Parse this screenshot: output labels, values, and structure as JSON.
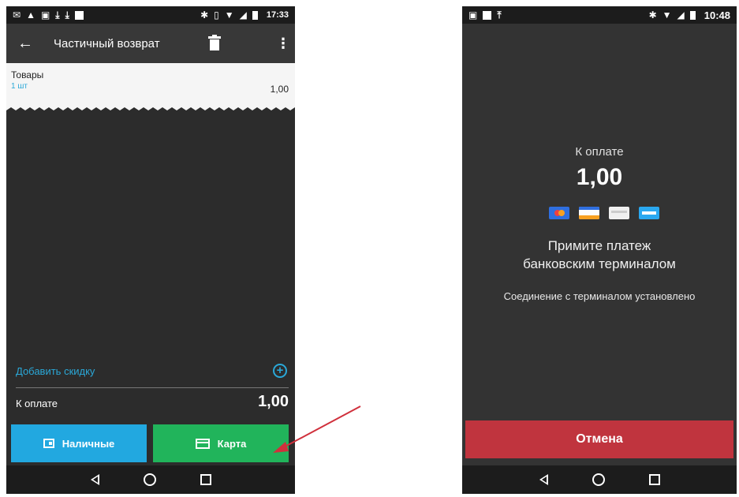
{
  "left_screen": {
    "status_time": "17:33",
    "toolbar": {
      "title": "Частичный возврат"
    },
    "receipt": {
      "item_name": "Товары",
      "item_qty": "1 шт",
      "item_price": "1,00"
    },
    "discount_link": "Добавить скидку",
    "total": {
      "label": "К оплате",
      "amount": "1,00"
    },
    "buttons": {
      "cash": "Наличные",
      "card": "Карта"
    }
  },
  "right_screen": {
    "status_time": "10:48",
    "pay_label": "К оплате",
    "pay_amount": "1,00",
    "message_line1": "Примите платеж",
    "message_line2": "банковским терминалом",
    "status": "Соединение с терминалом установлено",
    "cancel_button": "Отмена"
  },
  "colors": {
    "cash_button": "#22a8e0",
    "card_button": "#21b45b",
    "cancel_button": "#c0343e",
    "link": "#2aa8d8",
    "annotation_arrow": "#d0303c"
  },
  "icons": [
    "back-arrow-icon",
    "trash-icon",
    "more-vert-icon",
    "add-circle-icon",
    "wallet-icon",
    "credit-card-icon",
    "nav-back-icon",
    "nav-home-icon",
    "nav-recent-icon"
  ]
}
